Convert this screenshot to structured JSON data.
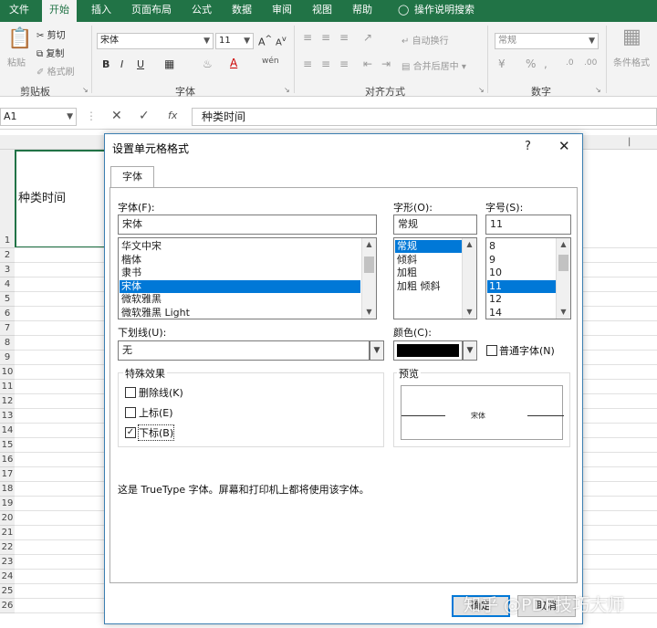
{
  "ribbon": {
    "tabs": [
      "文件",
      "开始",
      "插入",
      "页面布局",
      "公式",
      "数据",
      "审阅",
      "视图",
      "帮助",
      "操作说明搜索"
    ],
    "active_tab": "开始",
    "clipboard": {
      "paste": "粘贴",
      "cut": "剪切",
      "copy": "复制",
      "format_painter": "格式刷",
      "label": "剪贴板"
    },
    "font": {
      "name": "宋体",
      "size": "11",
      "bold": "B",
      "italic": "I",
      "underline": "U",
      "wen": "wén",
      "label": "字体"
    },
    "alignment": {
      "wrap": "自动换行",
      "merge": "合并后居中",
      "label": "对齐方式"
    },
    "number": {
      "format": "常规",
      "label": "数字"
    },
    "styles": {
      "conditional": "条件格式"
    },
    "accent": "#217346"
  },
  "formula_bar": {
    "name_box": "A1",
    "fx": "fx",
    "content": "种类时间"
  },
  "sheet": {
    "cell_a1": "种类时间",
    "rows": [
      "1",
      "2",
      "3",
      "4",
      "5",
      "6",
      "7",
      "8",
      "9",
      "10",
      "11",
      "12",
      "13",
      "14",
      "15",
      "16",
      "17",
      "18",
      "19",
      "20",
      "21",
      "22",
      "23",
      "24",
      "25",
      "26"
    ]
  },
  "dialog": {
    "title": "设置单元格格式",
    "help": "?",
    "close": "✕",
    "tab": "字体",
    "font_label": "字体(F):",
    "font_value": "宋体",
    "font_list": [
      "华文中宋",
      "楷体",
      "隶书",
      "宋体",
      "微软雅黑",
      "微软雅黑 Light"
    ],
    "font_selected": 3,
    "style_label": "字形(O):",
    "style_value": "常规",
    "style_list": [
      "常规",
      "倾斜",
      "加粗",
      "加粗 倾斜"
    ],
    "style_selected": 0,
    "size_label": "字号(S):",
    "size_value": "11",
    "size_list": [
      "8",
      "9",
      "10",
      "11",
      "12",
      "14"
    ],
    "size_selected": 3,
    "underline_label": "下划线(U):",
    "underline_value": "无",
    "color_label": "颜色(C):",
    "color_value": "#000000",
    "normal_font_label": "普通字体(N)",
    "normal_font_checked": false,
    "effects_label": "特殊效果",
    "strikethrough_label": "删除线(K)",
    "strikethrough_checked": false,
    "superscript_label": "上标(E)",
    "superscript_checked": false,
    "subscript_label": "下标(B)",
    "subscript_checked": true,
    "preview_label": "预览",
    "preview_text": "宋体",
    "info_text": "这是 TrueType 字体。屏幕和打印机上都将使用该字体。",
    "ok": "确定",
    "cancel": "取消"
  },
  "watermark": "知乎 @PDF技巧大师"
}
